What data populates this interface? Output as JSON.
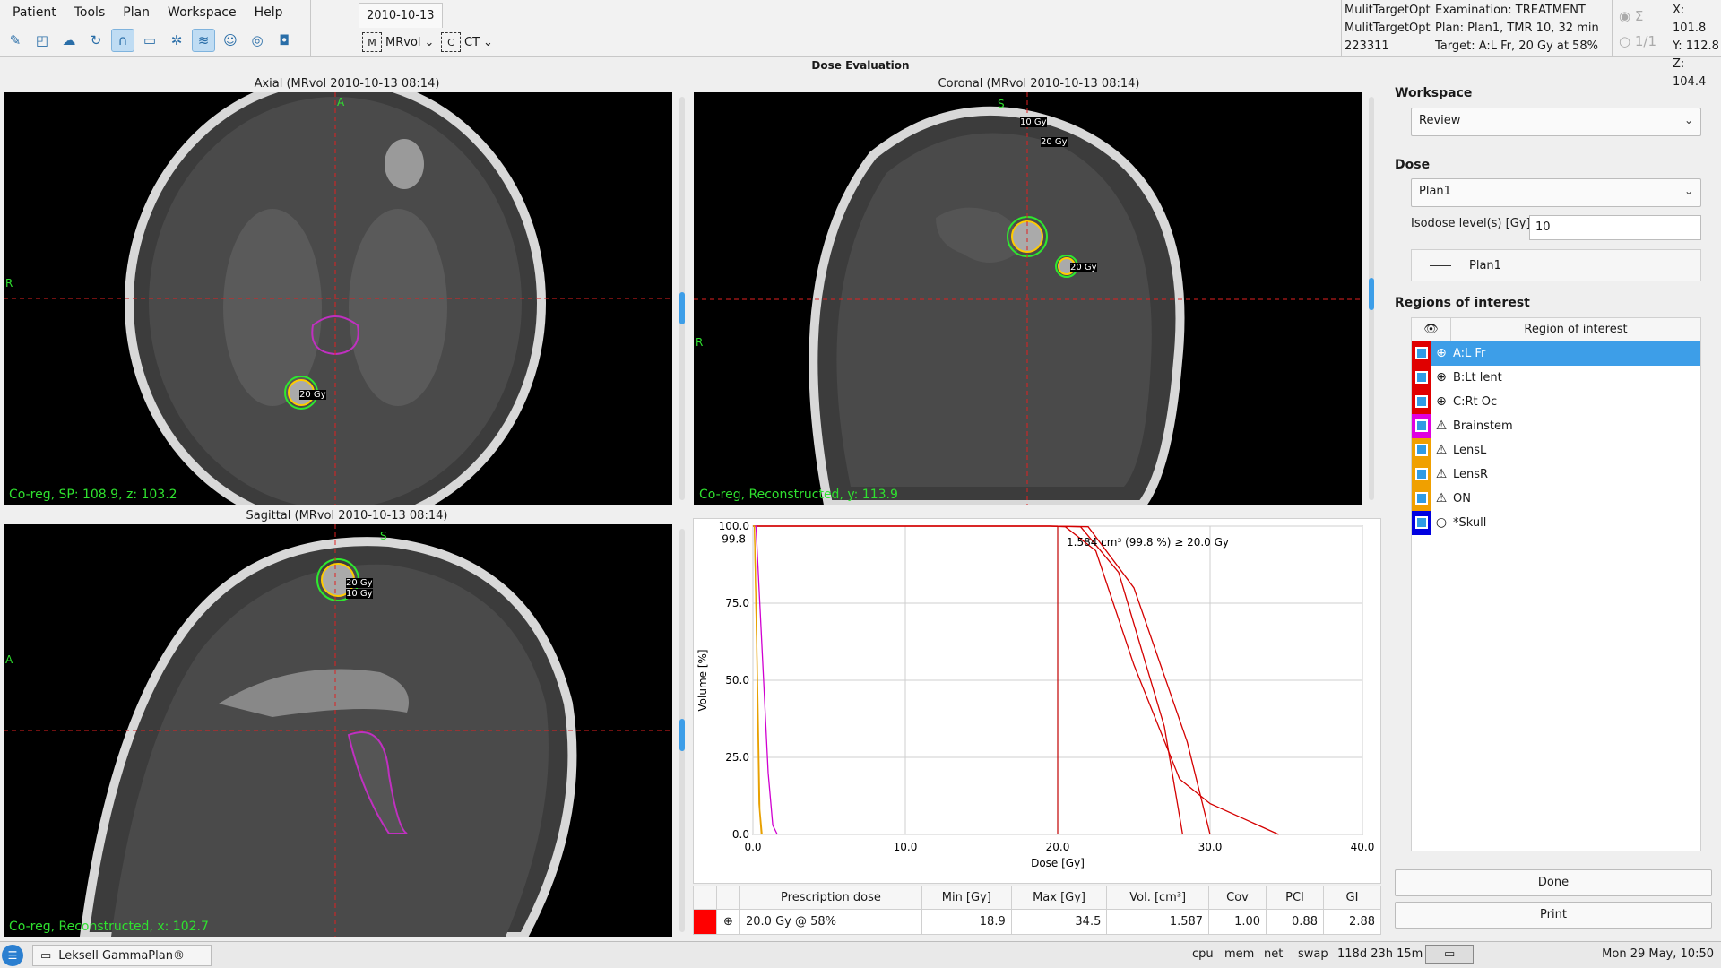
{
  "menu": [
    "Patient",
    "Tools",
    "Plan",
    "Workspace",
    "Help"
  ],
  "toolbar_icons": [
    "draw-icon",
    "contour-icon",
    "brain-icon",
    "rotate-icon",
    "curve-icon",
    "ruler-icon",
    "structure-icon",
    "dose-icon",
    "head-icon",
    "shot-icon",
    "camera-icon"
  ],
  "date_tab": "2010-10-13",
  "series": [
    {
      "label": "MRvol",
      "icon": "mrvol-icon"
    },
    {
      "label": "CT",
      "icon": "ct-icon"
    }
  ],
  "patient_info": [
    "MulitTargetOpt",
    "MulitTargetOpt",
    "223311"
  ],
  "plan_info": [
    "Examination: TREATMENT",
    "Plan: Plan1, TMR 10, 32 min",
    "Target: A:L Fr, 20 Gy at 58%"
  ],
  "sum": {
    "symbol": "Σ",
    "count": "1/1"
  },
  "coords": {
    "x": "X: 101.8",
    "y": "Y: 112.8",
    "z": "Z: 104.4"
  },
  "title": "Dose Evaluation",
  "viewports": {
    "axial": {
      "title": "Axial (MRvol 2010-10-13 08:14)",
      "status": "Co-reg, SP: 108.9, z: 103.2",
      "orient": [
        "A",
        "R"
      ],
      "labels": [
        "20 Gy"
      ]
    },
    "coronal": {
      "title": "Coronal (MRvol 2010-10-13 08:14)",
      "status": "Co-reg, Reconstructed, y: 113.9",
      "orient": [
        "S",
        "R"
      ],
      "labels": [
        "10 Gy",
        "20 Gy",
        "20 Gy"
      ]
    },
    "sagittal": {
      "title": "Sagittal (MRvol 2010-10-13 08:14)",
      "status": "Co-reg, Reconstructed, x: 102.7",
      "orient": [
        "S",
        "A"
      ],
      "labels": [
        "20 Gy",
        "10 Gy"
      ]
    }
  },
  "chart_data": {
    "type": "line",
    "title": "",
    "xlabel": "Dose [Gy]",
    "ylabel": "Volume [%]",
    "xlim": [
      0,
      40
    ],
    "ylim": [
      0,
      100
    ],
    "xticks": [
      "0.0",
      "10.0",
      "20.0",
      "30.0",
      "40.0"
    ],
    "yticks": [
      "0.0",
      "25.0",
      "50.0",
      "75.0",
      "100.0"
    ],
    "extra_ytick": "99.8",
    "grid": true,
    "annotation": "1.584 cm³ (99.8 %) ≥ 20.0 Gy",
    "marker_x": 20.0,
    "series": [
      {
        "color": "#d40000",
        "x": [
          0,
          19.5,
          20.5,
          22.5,
          25,
          28,
          30,
          34.5
        ],
        "y": [
          100,
          100,
          99.8,
          92,
          55,
          18,
          10,
          0
        ]
      },
      {
        "color": "#d40000",
        "x": [
          0,
          19.5,
          21.5,
          24,
          27,
          28.2
        ],
        "y": [
          100,
          100,
          99.8,
          85,
          35,
          0
        ]
      },
      {
        "color": "#d40000",
        "x": [
          0,
          19.5,
          22,
          25,
          28.5,
          30
        ],
        "y": [
          100,
          100,
          99.8,
          80,
          30,
          0
        ]
      },
      {
        "color": "#d000d0",
        "x": [
          0,
          0.2,
          0.5,
          1.0,
          1.3,
          1.6
        ],
        "y": [
          100,
          100,
          70,
          20,
          3,
          0
        ]
      },
      {
        "color": "#e8a000",
        "x": [
          0,
          0.1,
          0.25,
          0.4,
          0.55
        ],
        "y": [
          100,
          100,
          60,
          10,
          0
        ]
      },
      {
        "color": "#e8a000",
        "x": [
          0,
          0.1,
          0.3,
          0.45,
          0.6
        ],
        "y": [
          100,
          100,
          50,
          8,
          0
        ]
      }
    ]
  },
  "dose_table": {
    "headers": [
      "Prescription dose",
      "Min [Gy]",
      "Max [Gy]",
      "Vol. [cm³]",
      "Cov",
      "PCI",
      "GI"
    ],
    "row": {
      "color": "#ff0000",
      "prescription": "20.0 Gy @ 58%",
      "min": "18.9",
      "max": "34.5",
      "vol": "1.587",
      "cov": "1.00",
      "pci": "0.88",
      "gi": "2.88"
    }
  },
  "workspace": {
    "label": "Workspace",
    "value": "Review"
  },
  "dose": {
    "label": "Dose",
    "value": "Plan1",
    "iso_label": "Isodose level(s) [Gy]",
    "iso_value": "10",
    "legend": "Plan1"
  },
  "roi": {
    "label": "Regions of interest",
    "header": "Region of interest",
    "items": [
      {
        "name": "A:L Fr",
        "color": "#e00000",
        "type": "⊕",
        "selected": true
      },
      {
        "name": "B:Lt lent",
        "color": "#e00000",
        "type": "⊕",
        "selected": false
      },
      {
        "name": "C:Rt Oc",
        "color": "#e00000",
        "type": "⊕",
        "selected": false
      },
      {
        "name": "Brainstem",
        "color": "#e000e0",
        "type": "⚠",
        "selected": false
      },
      {
        "name": "LensL",
        "color": "#f0a000",
        "type": "⚠",
        "selected": false
      },
      {
        "name": "LensR",
        "color": "#f0a000",
        "type": "⚠",
        "selected": false
      },
      {
        "name": "ON",
        "color": "#f0a000",
        "type": "⚠",
        "selected": false
      },
      {
        "name": "*Skull",
        "color": "#0000e0",
        "type": "○",
        "selected": false
      }
    ]
  },
  "buttons": {
    "done": "Done",
    "print": "Print"
  },
  "taskbar": {
    "app": "Leksell GammaPlan®",
    "tray": [
      "cpu",
      "mem",
      "net",
      "swap",
      "118d 23h 15m"
    ],
    "clock": "Mon 29 May, 10:50"
  }
}
